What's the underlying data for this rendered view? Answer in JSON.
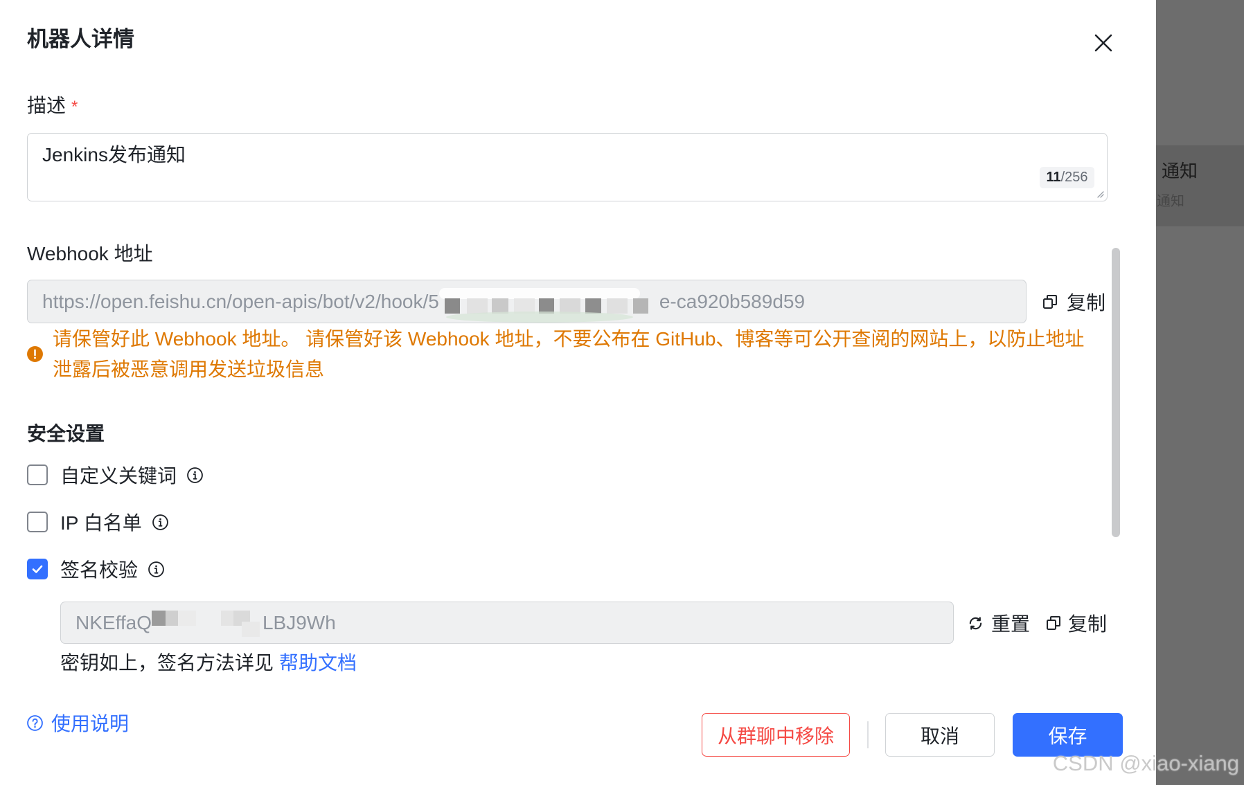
{
  "dialog": {
    "title": "机器人详情",
    "close_icon": "close-icon"
  },
  "description": {
    "label": "描述",
    "required_mark": "*",
    "value": "Jenkins发布通知",
    "count": "11",
    "count_limit": "/256"
  },
  "webhook": {
    "label": "Webhook 地址",
    "url_start": "https://open.feishu.cn/open-apis/bot/v2/hook/5",
    "url_end": "e-ca920b589d59",
    "copy_label": "复制",
    "copy_icon": "copy-icon",
    "warning_icon": "warning-circle-icon",
    "warning": "请保管好此 Webhook 地址。 请保管好该 Webhook 地址，不要公布在 GitHub、博客等可公开查阅的网站上，以防止地址泄露后被恶意调用发送垃圾信息"
  },
  "security": {
    "heading": "安全设置",
    "info_icon": "info-icon",
    "options": [
      {
        "label": "自定义关键词",
        "checked": false
      },
      {
        "label": "IP 白名单",
        "checked": false
      },
      {
        "label": "签名校验",
        "checked": true
      }
    ],
    "secret_start": "NKEffaQ",
    "secret_end": "LBJ9Wh",
    "reset_label": "重置",
    "reset_icon": "refresh-icon",
    "copy_label": "复制",
    "hint": "密钥如上，签名方法详见",
    "help_link": "帮助文档"
  },
  "footer": {
    "usage_icon": "question-circle-icon",
    "usage_link": "使用说明",
    "remove_button": "从群聊中移除",
    "cancel_button": "取消",
    "save_button": "保存"
  },
  "background_list": {
    "item_title": "通知",
    "item_subtitle": "通知"
  },
  "watermark": "CSDN @xiao-xiang",
  "colors": {
    "primary": "#3370ff",
    "danger": "#f54a45",
    "warning": "#de7802"
  }
}
